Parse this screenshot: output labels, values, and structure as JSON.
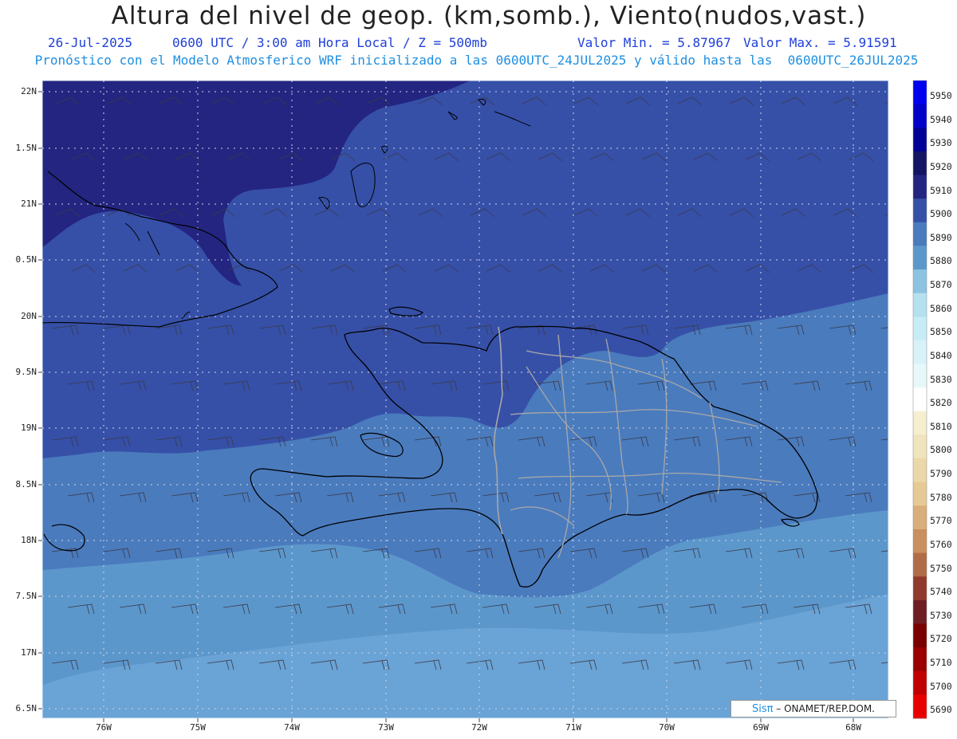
{
  "header": {
    "title": "Altura del nivel de geop. (km,somb.), Viento(nudos,vast.)",
    "date": "26-Jul-2025",
    "time": "0600 UTC / 3:00 am Hora Local / Z = 500mb",
    "min_value": "Valor Min. = 5.87967",
    "max_value": "Valor Max. = 5.91591",
    "model_info": "Pronóstico con el Modelo Atmosferico WRF inicializado a las 0600UTC_24JUL2025 y válido hasta las  0600UTC_26JUL2025"
  },
  "axes": {
    "lat_labels": [
      "22N",
      "1.5N",
      "21N",
      "0.5N",
      "20N",
      "9.5N",
      "19N",
      "8.5N",
      "18N",
      "7.5N",
      "17N",
      "6.5N"
    ],
    "lon_labels": [
      "76W",
      "75W",
      "74W",
      "73W",
      "72W",
      "71W",
      "70W",
      "69W",
      "68W"
    ]
  },
  "colorbar": {
    "labels": [
      "5950",
      "5940",
      "5930",
      "5920",
      "5910",
      "5900",
      "5890",
      "5880",
      "5870",
      "5860",
      "5850",
      "5840",
      "5830",
      "5820",
      "5810",
      "5800",
      "5790",
      "5780",
      "5770",
      "5760",
      "5750",
      "5740",
      "5730",
      "5720",
      "5710",
      "5700",
      "5690"
    ],
    "colors": [
      "#0000f0",
      "#0000c8",
      "#000096",
      "#141464",
      "#232580",
      "#3650a8",
      "#4a7bbd",
      "#5c97cc",
      "#8cc3e0",
      "#b4e0f0",
      "#c8ecf5",
      "#d8f2f8",
      "#e6f8fa",
      "#ffffff",
      "#f5efcf",
      "#f0e4bd",
      "#ebd8a8",
      "#e6c995",
      "#d9ae7a",
      "#c98f5e",
      "#b06c47",
      "#8f3a2c",
      "#6e1d22",
      "#7a0000",
      "#9a0000",
      "#c00000",
      "#e80000"
    ]
  },
  "map": {
    "shading_colors": {
      "darkest": "#232580",
      "dark": "#3650a8",
      "medium": "#4a7bbd",
      "light": "#5c97cc",
      "lightest": "#6aa3d5"
    },
    "coastline_color": "#000000",
    "border_color": "#a8a8a8"
  },
  "credit": {
    "logo": "Sisπ",
    "text": "– ONAMET/REP.DOM."
  }
}
